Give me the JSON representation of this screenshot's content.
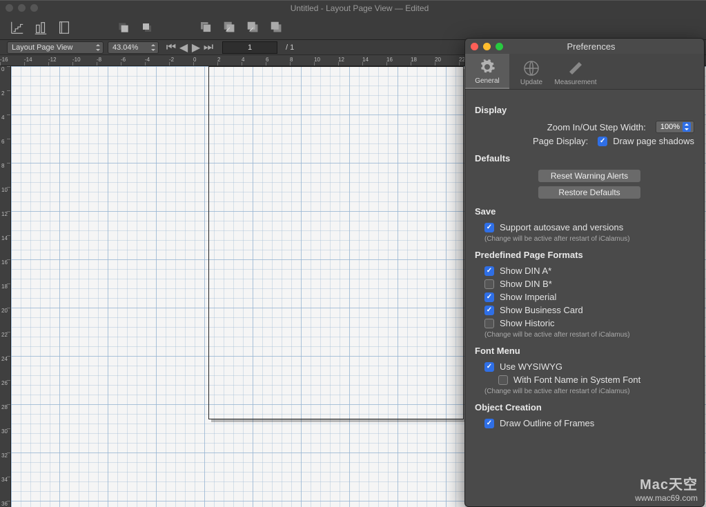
{
  "window": {
    "title": "Untitled - Layout Page View — Edited"
  },
  "subbar": {
    "view_mode": "Layout Page View",
    "zoom": "43.04%",
    "page_current": "1",
    "page_total": "/ 1"
  },
  "ruler_h": [
    "-16",
    "-14",
    "-12",
    "-10",
    "-8",
    "-6",
    "-4",
    "-2",
    "0",
    "2",
    "4",
    "6",
    "8",
    "10",
    "12",
    "14",
    "16",
    "18",
    "20",
    "22"
  ],
  "ruler_v": [
    "0",
    "2",
    "4",
    "6",
    "8",
    "10",
    "12",
    "14",
    "16",
    "18",
    "20",
    "22",
    "24",
    "26",
    "28",
    "30",
    "32",
    "34",
    "36"
  ],
  "prefs": {
    "title": "Preferences",
    "tabs": {
      "general": "General",
      "update": "Update",
      "measurement": "Measurement"
    },
    "display": {
      "heading": "Display",
      "zoom_label": "Zoom In/Out Step Width:",
      "zoom_value": "100%",
      "page_display_label": "Page Display:",
      "draw_shadows": "Draw page shadows"
    },
    "defaults": {
      "heading": "Defaults",
      "reset_btn": "Reset Warning Alerts",
      "restore_btn": "Restore Defaults"
    },
    "save": {
      "heading": "Save",
      "autosave": "Support autosave and versions",
      "note": "(Change will be active after restart of iCalamus)"
    },
    "page_formats": {
      "heading": "Predefined Page Formats",
      "din_a": "Show DIN A*",
      "din_b": "Show DIN B*",
      "imperial": "Show Imperial",
      "business": "Show Business Card",
      "historic": "Show Historic",
      "note": "(Change will be active after restart of iCalamus)"
    },
    "font_menu": {
      "heading": "Font Menu",
      "wysiwyg": "Use WYSIWYG",
      "system_font": "With Font Name in System Font",
      "note": "(Change will be active after restart of iCalamus)"
    },
    "object_creation": {
      "heading": "Object Creation",
      "outline": "Draw Outline of Frames"
    }
  },
  "watermark": {
    "brand": "Mac天空",
    "url": "www.mac69.com"
  }
}
